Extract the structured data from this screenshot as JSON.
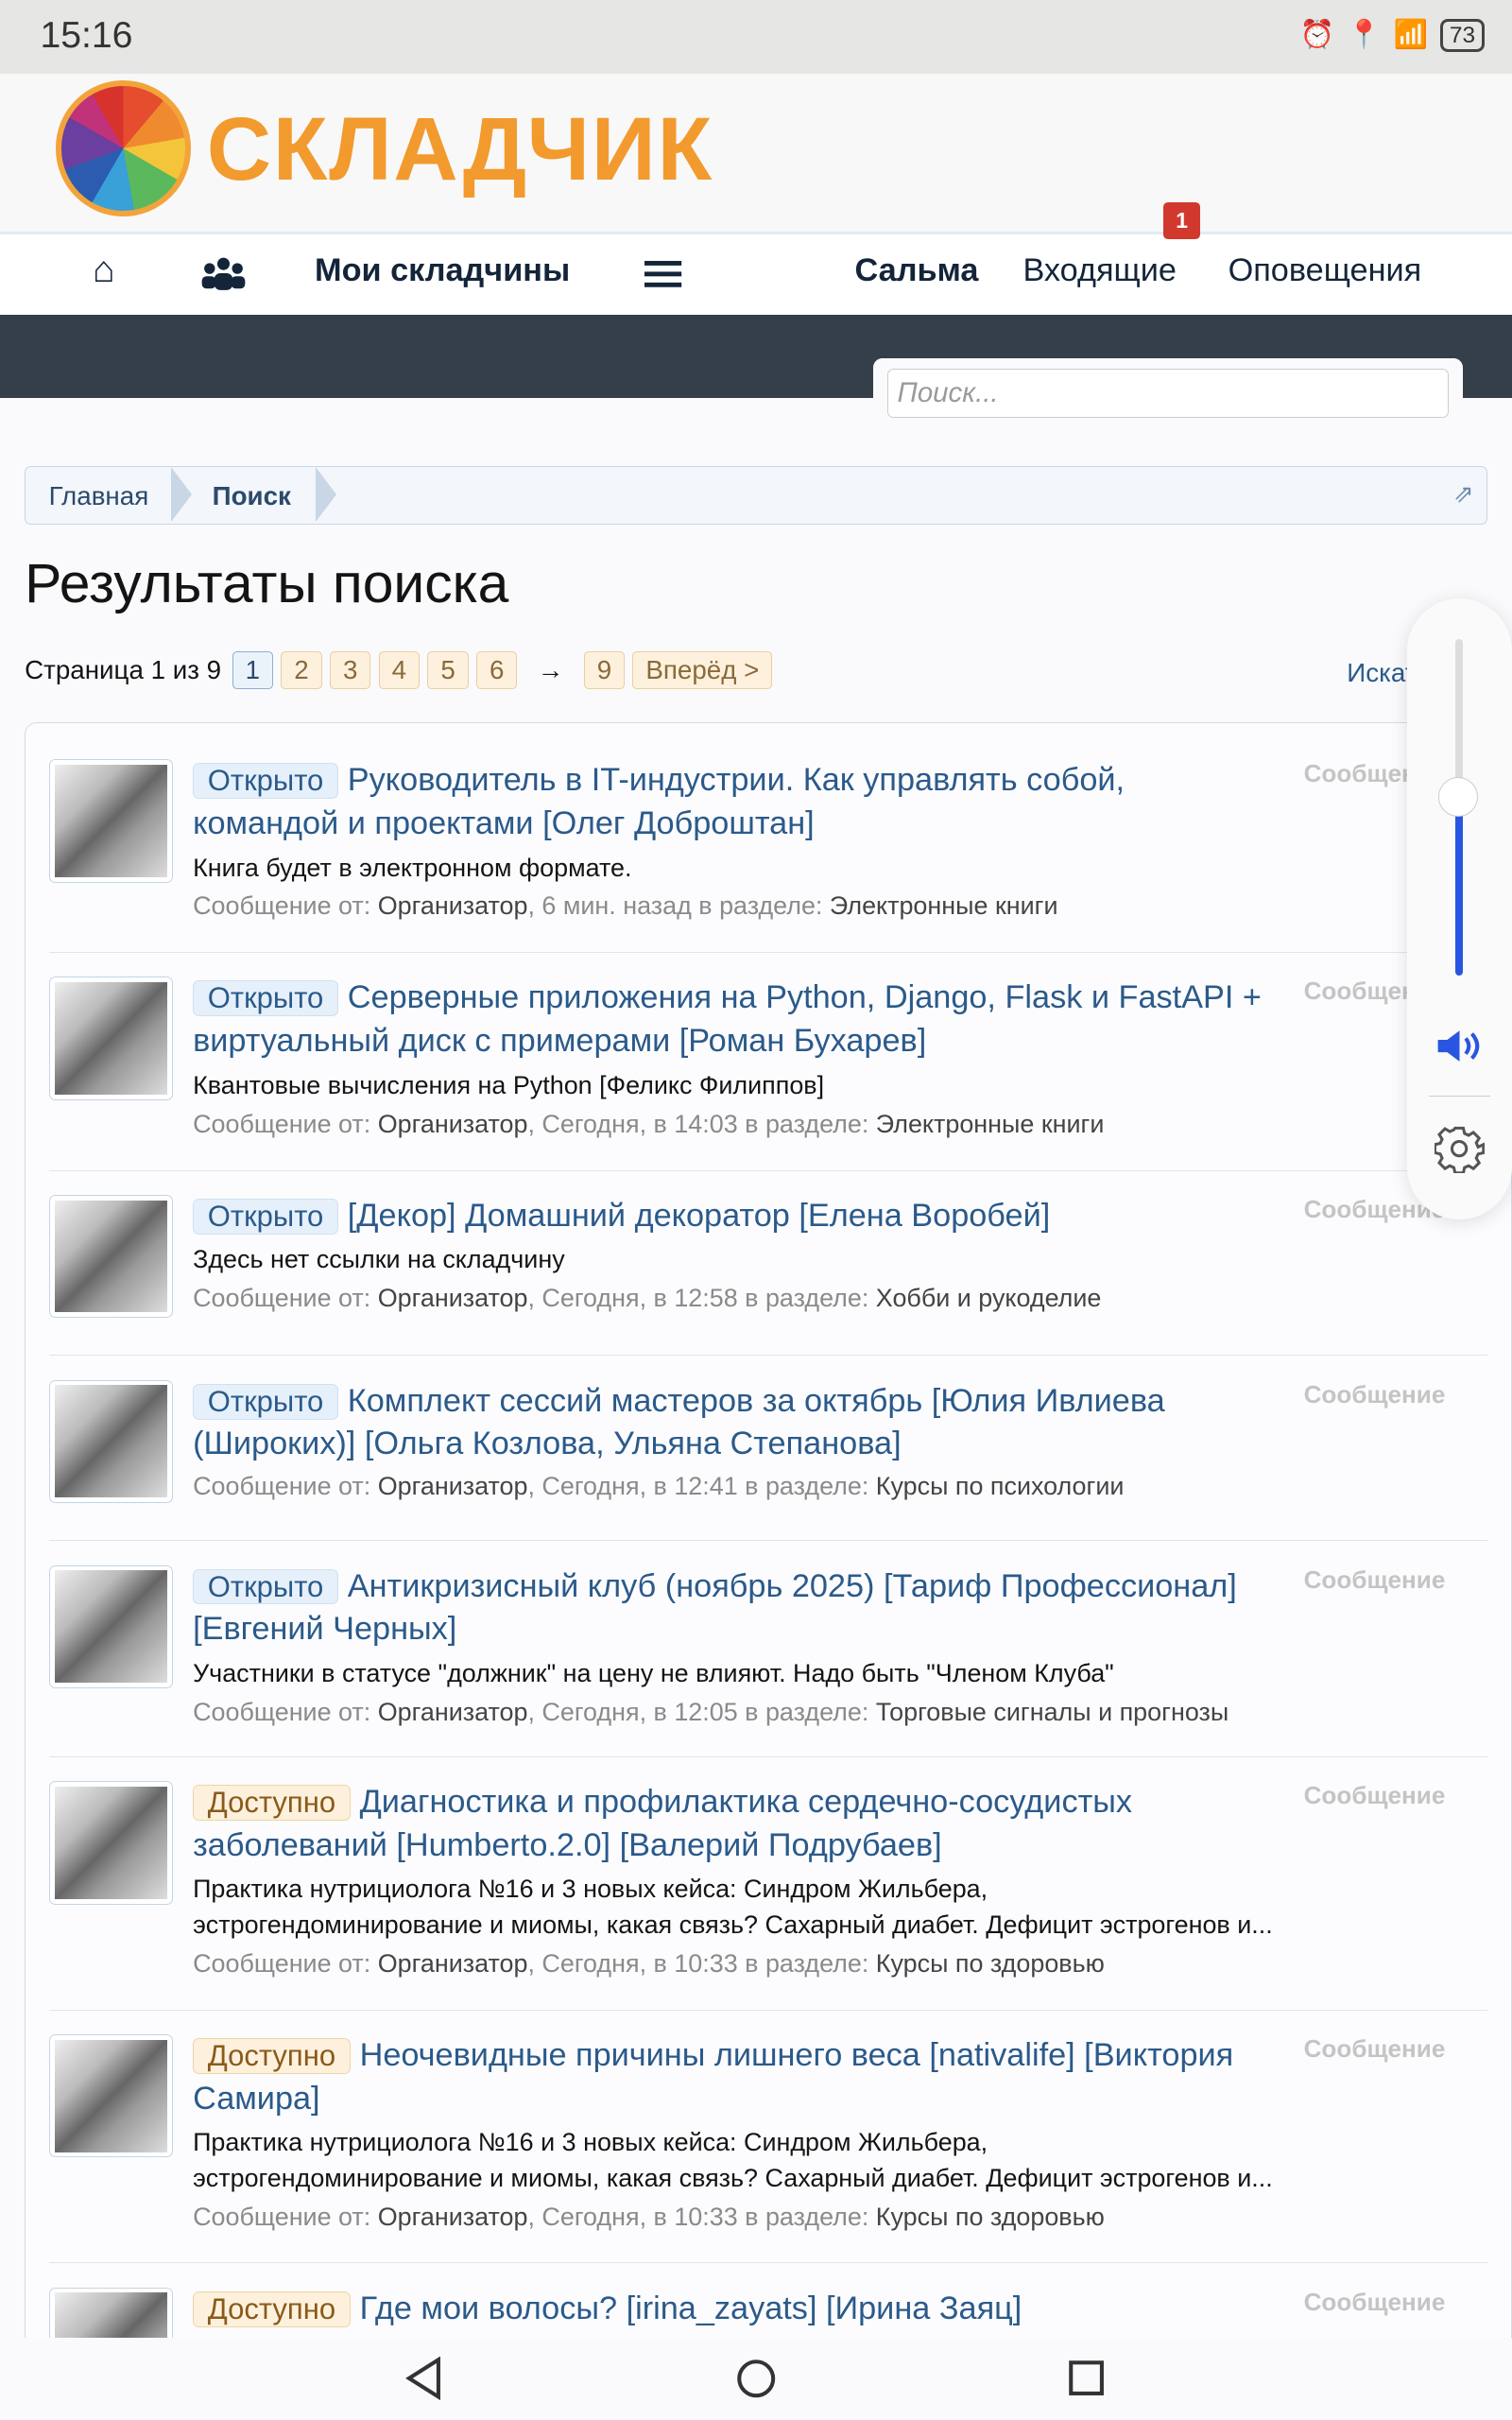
{
  "status": {
    "time": "15:16",
    "battery": "73"
  },
  "header": {
    "logo_text": "СКЛАДЧИК"
  },
  "nav": {
    "my": "Мои складчины",
    "user": "Сальма",
    "inbox": "Входящие",
    "inbox_badge": "1",
    "alerts": "Оповещения"
  },
  "search": {
    "placeholder": "Поиск..."
  },
  "breadcrumb": {
    "home": "Главная",
    "current": "Поиск"
  },
  "page": {
    "title": "Результаты поиска",
    "search_for": "Искать"
  },
  "pager": {
    "label": "Страница 1 из 9",
    "pages": [
      "1",
      "2",
      "3",
      "4",
      "5",
      "6"
    ],
    "current": "1",
    "arrow": "→",
    "last": "9",
    "next": "Вперёд >"
  },
  "results": [
    {
      "status": "Открыто",
      "type": "open",
      "title": "Руководитель в IT-индустрии. Как управлять собой, командой и проектами [Олег Доброштан]",
      "snippet": "Книга будет в электронном формате.",
      "from_label": "Сообщение от:",
      "author": "Организатор",
      "time": ", 6 мин. назад в разделе:",
      "forum": "Электронные книги",
      "kind": "Сообщение"
    },
    {
      "status": "Открыто",
      "type": "open",
      "title": "Серверные приложения на Python, Django, Flask и FastAPI + виртуальный диск с примерами [Роман Бухарев]",
      "snippet": "Квантовые вычисления на Python [Феликс Филиппов]",
      "from_label": "Сообщение от:",
      "author": "Организатор",
      "time": ", Сегодня, в 14:03 в разделе:",
      "forum": "Электронные книги",
      "kind": "Сообщение"
    },
    {
      "status": "Открыто",
      "type": "open",
      "title": "[Декор] Домашний декоратор [Елена Воробей]",
      "snippet": "Здесь нет ссылки на складчину",
      "from_label": "Сообщение от:",
      "author": "Организатор",
      "time": ", Сегодня, в 12:58 в разделе:",
      "forum": "Хобби и рукоделие",
      "kind": "Сообщение"
    },
    {
      "status": "Открыто",
      "type": "open",
      "title": "Комплект сессий мастеров за октябрь [Юлия Ивлиева (Широких)] [Ольга Козлова, Ульяна Степанова]",
      "snippet": "",
      "from_label": "Сообщение от:",
      "author": "Организатор",
      "time": ", Сегодня, в 12:41 в разделе:",
      "forum": "Курсы по психологии",
      "kind": "Сообщение"
    },
    {
      "status": "Открыто",
      "type": "open",
      "title": "Антикризисный клуб (ноябрь 2025) [Тариф Профессионал] [Евгений Черных]",
      "snippet": "Участники в статусе \"должник\" на цену не влияют. Надо быть \"Членом Клуба\"",
      "from_label": "Сообщение от:",
      "author": "Организатор",
      "time": ", Сегодня, в 12:05 в разделе:",
      "forum": "Торговые сигналы и прогнозы",
      "kind": "Сообщение"
    },
    {
      "status": "Доступно",
      "type": "avail",
      "title": "Диагностика и профилактика сердечно-сосудистых заболеваний [Humberto.2.0] [Валерий Подрубаев]",
      "snippet": "Практика нутрициолога №16 и 3 новых кейса: Синдром Жильбера, эстрогендоминирование и миомы, какая связь? Сахарный диабет. Дефицит эстрогенов и...",
      "from_label": "Сообщение от:",
      "author": "Организатор",
      "time": ", Сегодня, в 10:33 в разделе:",
      "forum": "Курсы по здоровью",
      "kind": "Сообщение"
    },
    {
      "status": "Доступно",
      "type": "avail",
      "title": "Неочевидные причины лишнего веса [nativalife] [Виктория Самира]",
      "snippet": "Практика нутрициолога №16 и 3 новых кейса: Синдром Жильбера, эстрогендоминирование и миомы, какая связь? Сахарный диабет. Дефицит эстрогенов и...",
      "from_label": "Сообщение от:",
      "author": "Организатор",
      "time": ", Сегодня, в 10:33 в разделе:",
      "forum": "Курсы по здоровью",
      "kind": "Сообщение"
    },
    {
      "status": "Доступно",
      "type": "avail",
      "title": "Где мои волосы? [irina_zayats] [Ирина Заяц]",
      "snippet": "",
      "from_label": "",
      "author": "",
      "time": "",
      "forum": "",
      "kind": "Сообщение"
    }
  ],
  "volume": {
    "level": 0.53,
    "accent": "#2956e0"
  }
}
